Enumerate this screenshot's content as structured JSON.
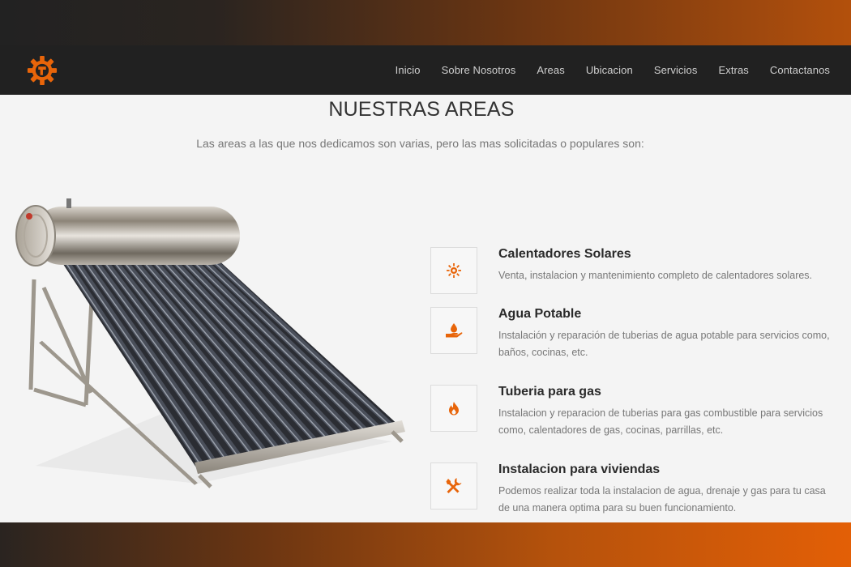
{
  "nav": {
    "logo_icon": "gear-wrench-logo",
    "items": [
      "Inicio",
      "Sobre Nosotros",
      "Areas",
      "Ubicacion",
      "Servicios",
      "Extras",
      "Contactanos"
    ]
  },
  "section": {
    "title": "NUESTRAS AREAS",
    "subtitle": "Las areas a las que nos dedicamos son varias, pero las mas solicitadas o populares son:"
  },
  "areas": [
    {
      "icon": "sun-icon",
      "title": "Calentadores Solares",
      "description": "Venta, instalacion y mantenimiento completo de calentadores solares."
    },
    {
      "icon": "water-hand-icon",
      "title": "Agua Potable",
      "description": "Instalación y reparación de tuberias de agua potable para servicios como, baños, cocinas, etc."
    },
    {
      "icon": "flame-icon",
      "title": "Tuberia para gas",
      "description": "Instalacion y reparacion de tuberias para gas combustible para servicios como, calentadores de gas, cocinas, parrillas, etc."
    },
    {
      "icon": "tools-icon",
      "title": "Instalacion para viviendas",
      "description": "Podemos realizar toda la instalacion de agua, drenaje y gas para tu casa de una manera optima para su buen funcionamiento."
    }
  ],
  "colors": {
    "accent": "#e8650a",
    "navbar": "#212121",
    "background": "#f4f4f4"
  }
}
